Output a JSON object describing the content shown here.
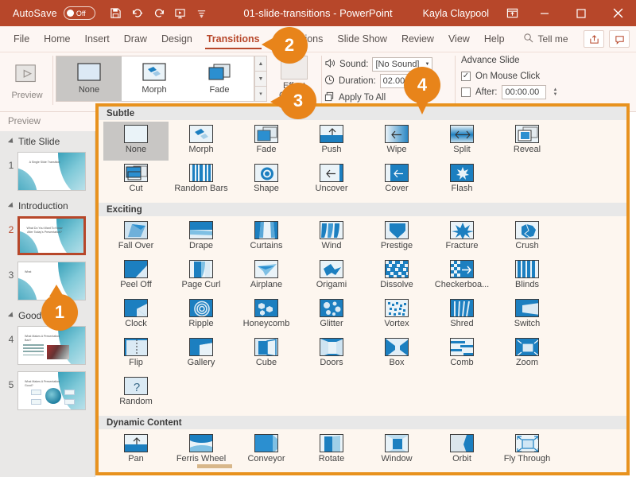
{
  "titlebar": {
    "autosave_label": "AutoSave",
    "autosave_state": "Off",
    "document_title": "01-slide-transitions  -  PowerPoint",
    "user_name": "Kayla Claypool",
    "qat": [
      {
        "name": "save-icon",
        "label": "Save"
      },
      {
        "name": "undo-icon",
        "label": "Undo"
      },
      {
        "name": "redo-icon",
        "label": "Redo"
      },
      {
        "name": "start-slideshow-icon",
        "label": "Start From Beginning"
      },
      {
        "name": "customize-qat-icon",
        "label": "Customize Quick Access Toolbar"
      }
    ],
    "window_buttons": [
      {
        "name": "ribbon-display-options",
        "glyph": "⬒"
      },
      {
        "name": "minimize-button",
        "glyph": "–"
      },
      {
        "name": "maximize-button",
        "glyph": "□"
      },
      {
        "name": "close-button",
        "glyph": "✕"
      }
    ],
    "accent_color": "#b7472a"
  },
  "menubar": {
    "items": [
      {
        "label": "File",
        "active": false
      },
      {
        "label": "Home",
        "active": false
      },
      {
        "label": "Insert",
        "active": false
      },
      {
        "label": "Draw",
        "active": false
      },
      {
        "label": "Design",
        "active": false
      },
      {
        "label": "Transitions",
        "active": true
      },
      {
        "label": "Animations",
        "active": false
      },
      {
        "label": "Slide Show",
        "active": false
      },
      {
        "label": "Review",
        "active": false
      },
      {
        "label": "View",
        "active": false
      },
      {
        "label": "Help",
        "active": false
      }
    ],
    "tell_me": "Tell me",
    "share_label": "Share",
    "comments_label": "Comments"
  },
  "ribbon": {
    "preview_label": "Preview",
    "gallery": [
      {
        "label": "None",
        "selected": true
      },
      {
        "label": "Morph",
        "selected": false
      },
      {
        "label": "Fade",
        "selected": false
      }
    ],
    "scroll_buttons": [
      {
        "name": "gallery-scroll-up",
        "glyph": "▲"
      },
      {
        "name": "gallery-scroll-down",
        "glyph": "▼"
      },
      {
        "name": "gallery-more",
        "glyph": "▾"
      }
    ],
    "effect_options_label": "Effect\nOptions",
    "sound_label": "Sound:",
    "sound_value": "[No Sound]",
    "duration_label": "Duration:",
    "duration_value": "02.00",
    "apply_to_all_label": "Apply To All",
    "advance_slide_label": "Advance Slide",
    "on_mouse_click_label": "On Mouse Click",
    "on_mouse_click_checked": true,
    "after_label": "After:",
    "after_value": "00:00.00",
    "after_checked": false
  },
  "left_pane": {
    "preview_label": "Preview",
    "sections": [
      {
        "title": "Title Slide",
        "slides": [
          {
            "number": "1",
            "title": "A Single Slide Transition",
            "layout": "title",
            "current": false
          }
        ]
      },
      {
        "title": "Introduction",
        "slides": [
          {
            "number": "2",
            "title": "What Do You Want To Know After Today's Presentation?",
            "layout": "title",
            "current": true
          },
          {
            "number": "3",
            "title": "What",
            "layout": "title",
            "current": false
          }
        ]
      },
      {
        "title": "Good vs. Bad",
        "slides": [
          {
            "number": "4",
            "title": "What Makes A Presentation Bad?",
            "layout": "bullets-photo",
            "current": false
          },
          {
            "number": "5",
            "title": "What Makes A Presentation Good?",
            "layout": "diagram",
            "current": false
          }
        ]
      }
    ]
  },
  "dropdown": {
    "border_color": "#e8921e",
    "categories": [
      {
        "name": "Subtle",
        "items": [
          {
            "label": "None",
            "icon": "none-icon",
            "selected": true
          },
          {
            "label": "Morph",
            "icon": "morph-icon",
            "selected": false
          },
          {
            "label": "Fade",
            "icon": "fade-icon",
            "selected": false
          },
          {
            "label": "Push",
            "icon": "push-icon",
            "selected": false
          },
          {
            "label": "Wipe",
            "icon": "wipe-icon",
            "selected": false
          },
          {
            "label": "Split",
            "icon": "split-icon",
            "selected": false
          },
          {
            "label": "Reveal",
            "icon": "reveal-icon",
            "selected": false
          },
          {
            "label": "Cut",
            "icon": "cut-icon",
            "selected": false
          },
          {
            "label": "Random Bars",
            "icon": "random-bars-icon",
            "selected": false
          },
          {
            "label": "Shape",
            "icon": "shape-icon",
            "selected": false
          },
          {
            "label": "Uncover",
            "icon": "uncover-icon",
            "selected": false
          },
          {
            "label": "Cover",
            "icon": "cover-icon",
            "selected": false
          },
          {
            "label": "Flash",
            "icon": "flash-icon",
            "selected": false
          }
        ]
      },
      {
        "name": "Exciting",
        "items": [
          {
            "label": "Fall Over",
            "icon": "fall-over-icon",
            "selected": false
          },
          {
            "label": "Drape",
            "icon": "drape-icon",
            "selected": false
          },
          {
            "label": "Curtains",
            "icon": "curtains-icon",
            "selected": false
          },
          {
            "label": "Wind",
            "icon": "wind-icon",
            "selected": false
          },
          {
            "label": "Prestige",
            "icon": "prestige-icon",
            "selected": false
          },
          {
            "label": "Fracture",
            "icon": "fracture-icon",
            "selected": false
          },
          {
            "label": "Crush",
            "icon": "crush-icon",
            "selected": false
          },
          {
            "label": "Peel Off",
            "icon": "peel-off-icon",
            "selected": false
          },
          {
            "label": "Page Curl",
            "icon": "page-curl-icon",
            "selected": false
          },
          {
            "label": "Airplane",
            "icon": "airplane-icon",
            "selected": false
          },
          {
            "label": "Origami",
            "icon": "origami-icon",
            "selected": false
          },
          {
            "label": "Dissolve",
            "icon": "dissolve-icon",
            "selected": false
          },
          {
            "label": "Checkerboa...",
            "icon": "checkerboard-icon",
            "selected": false
          },
          {
            "label": "Blinds",
            "icon": "blinds-icon",
            "selected": false
          },
          {
            "label": "Clock",
            "icon": "clock-icon",
            "selected": false
          },
          {
            "label": "Ripple",
            "icon": "ripple-icon",
            "selected": false
          },
          {
            "label": "Honeycomb",
            "icon": "honeycomb-icon",
            "selected": false
          },
          {
            "label": "Glitter",
            "icon": "glitter-icon",
            "selected": false
          },
          {
            "label": "Vortex",
            "icon": "vortex-icon",
            "selected": false
          },
          {
            "label": "Shred",
            "icon": "shred-icon",
            "selected": false
          },
          {
            "label": "Switch",
            "icon": "switch-icon",
            "selected": false
          },
          {
            "label": "Flip",
            "icon": "flip-icon",
            "selected": false
          },
          {
            "label": "Gallery",
            "icon": "gallery-icon",
            "selected": false
          },
          {
            "label": "Cube",
            "icon": "cube-icon",
            "selected": false
          },
          {
            "label": "Doors",
            "icon": "doors-icon",
            "selected": false
          },
          {
            "label": "Box",
            "icon": "box-icon",
            "selected": false
          },
          {
            "label": "Comb",
            "icon": "comb-icon",
            "selected": false
          },
          {
            "label": "Zoom",
            "icon": "zoom-icon",
            "selected": false
          },
          {
            "label": "Random",
            "icon": "random-icon",
            "selected": false
          }
        ]
      },
      {
        "name": "Dynamic Content",
        "items": [
          {
            "label": "Pan",
            "icon": "pan-icon",
            "selected": false
          },
          {
            "label": "Ferris Wheel",
            "icon": "ferris-wheel-icon",
            "selected": false
          },
          {
            "label": "Conveyor",
            "icon": "conveyor-icon",
            "selected": false
          },
          {
            "label": "Rotate",
            "icon": "rotate-icon",
            "selected": false
          },
          {
            "label": "Window",
            "icon": "window-icon",
            "selected": false
          },
          {
            "label": "Orbit",
            "icon": "orbit-icon",
            "selected": false
          },
          {
            "label": "Fly Through",
            "icon": "fly-through-icon",
            "selected": false
          }
        ]
      }
    ]
  },
  "callouts": [
    {
      "number": "1",
      "target": "slide-2-thumbnail"
    },
    {
      "number": "2",
      "target": "transitions-tab"
    },
    {
      "number": "3",
      "target": "gallery-more-button"
    },
    {
      "number": "4",
      "target": "transition-gallery-dropdown"
    }
  ]
}
